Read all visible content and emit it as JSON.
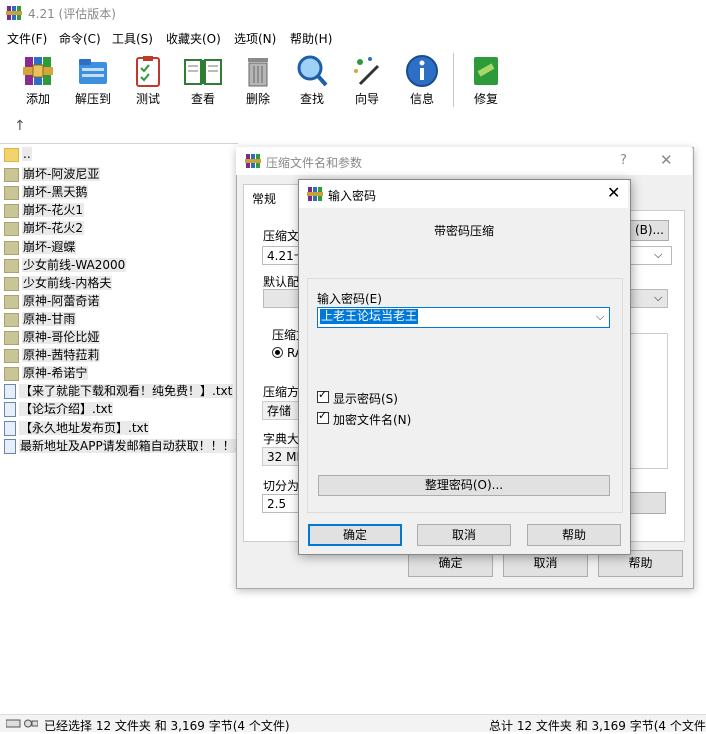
{
  "app": {
    "title": "4.21 (评估版本)"
  },
  "menu": [
    "文件(F)",
    "命令(C)",
    "工具(S)",
    "收藏夹(O)",
    "选项(N)",
    "帮助(H)"
  ],
  "toolbar": [
    {
      "label": "添加",
      "icon": "add-archive-icon"
    },
    {
      "label": "解压到",
      "icon": "extract-folder-icon"
    },
    {
      "label": "测试",
      "icon": "test-clipboard-icon"
    },
    {
      "label": "查看",
      "icon": "view-book-icon"
    },
    {
      "label": "删除",
      "icon": "delete-trash-icon"
    },
    {
      "label": "查找",
      "icon": "find-magnifier-icon"
    },
    {
      "label": "向导",
      "icon": "wizard-wand-icon"
    },
    {
      "label": "信息",
      "icon": "info-icon"
    },
    {
      "label": "修复",
      "icon": "repair-kit-icon"
    }
  ],
  "files": [
    {
      "name": "..",
      "type": "up"
    },
    {
      "name": "崩坏-阿波尼亚",
      "type": "folder"
    },
    {
      "name": "崩坏-黑天鹅",
      "type": "folder"
    },
    {
      "name": "崩坏-花火1",
      "type": "folder"
    },
    {
      "name": "崩坏-花火2",
      "type": "folder"
    },
    {
      "name": "崩坏-遐蝶",
      "type": "folder"
    },
    {
      "name": "少女前线-WA2000",
      "type": "folder"
    },
    {
      "name": "少女前线-内格夫",
      "type": "folder"
    },
    {
      "name": "原神-阿蕾奇诺",
      "type": "folder"
    },
    {
      "name": "原神-甘雨",
      "type": "folder"
    },
    {
      "name": "原神-哥伦比娅",
      "type": "folder"
    },
    {
      "name": "原神-茜特菈莉",
      "type": "folder"
    },
    {
      "name": "原神-希诺宁",
      "type": "folder"
    },
    {
      "name": "【来了就能下载和观看！纯免费！】.txt",
      "type": "txt"
    },
    {
      "name": "【论坛介绍】.txt",
      "type": "txt"
    },
    {
      "name": "【永久地址发布页】.txt",
      "type": "txt"
    },
    {
      "name": "最新地址及APP请发邮箱自动获取！！！.",
      "type": "txt"
    }
  ],
  "status": {
    "left": "已经选择 12 文件夹 和 3,169 字节(4 个文件)",
    "right": "总计 12 文件夹 和 3,169 字节(4 个文件)"
  },
  "archive_dialog": {
    "title": "压缩文件名和参数",
    "help": "?",
    "tab": "常规",
    "archive_name_label": "压缩文",
    "archive_name_value": "4.21卡",
    "browse": "(B)...",
    "profile_label": "默认配",
    "format_group": "压缩文",
    "format_rar": "RA",
    "method_label": "压缩方",
    "method_value": "存储",
    "dict_label": "字典大",
    "dict_value": "32 MB",
    "split_label": "切分为",
    "split_value": "2.5",
    "ok": "确定",
    "cancel": "取消",
    "help_button": "帮助"
  },
  "password_dialog": {
    "title": "输入密码",
    "heading": "带密码压缩",
    "field_label": "输入密码(E)",
    "password": "上老王论坛当老王",
    "show_password": "显示密码(S)",
    "encrypt_names": "加密文件名(N)",
    "organize": "整理密码(O)...",
    "ok": "确定",
    "cancel": "取消",
    "help": "帮助"
  }
}
